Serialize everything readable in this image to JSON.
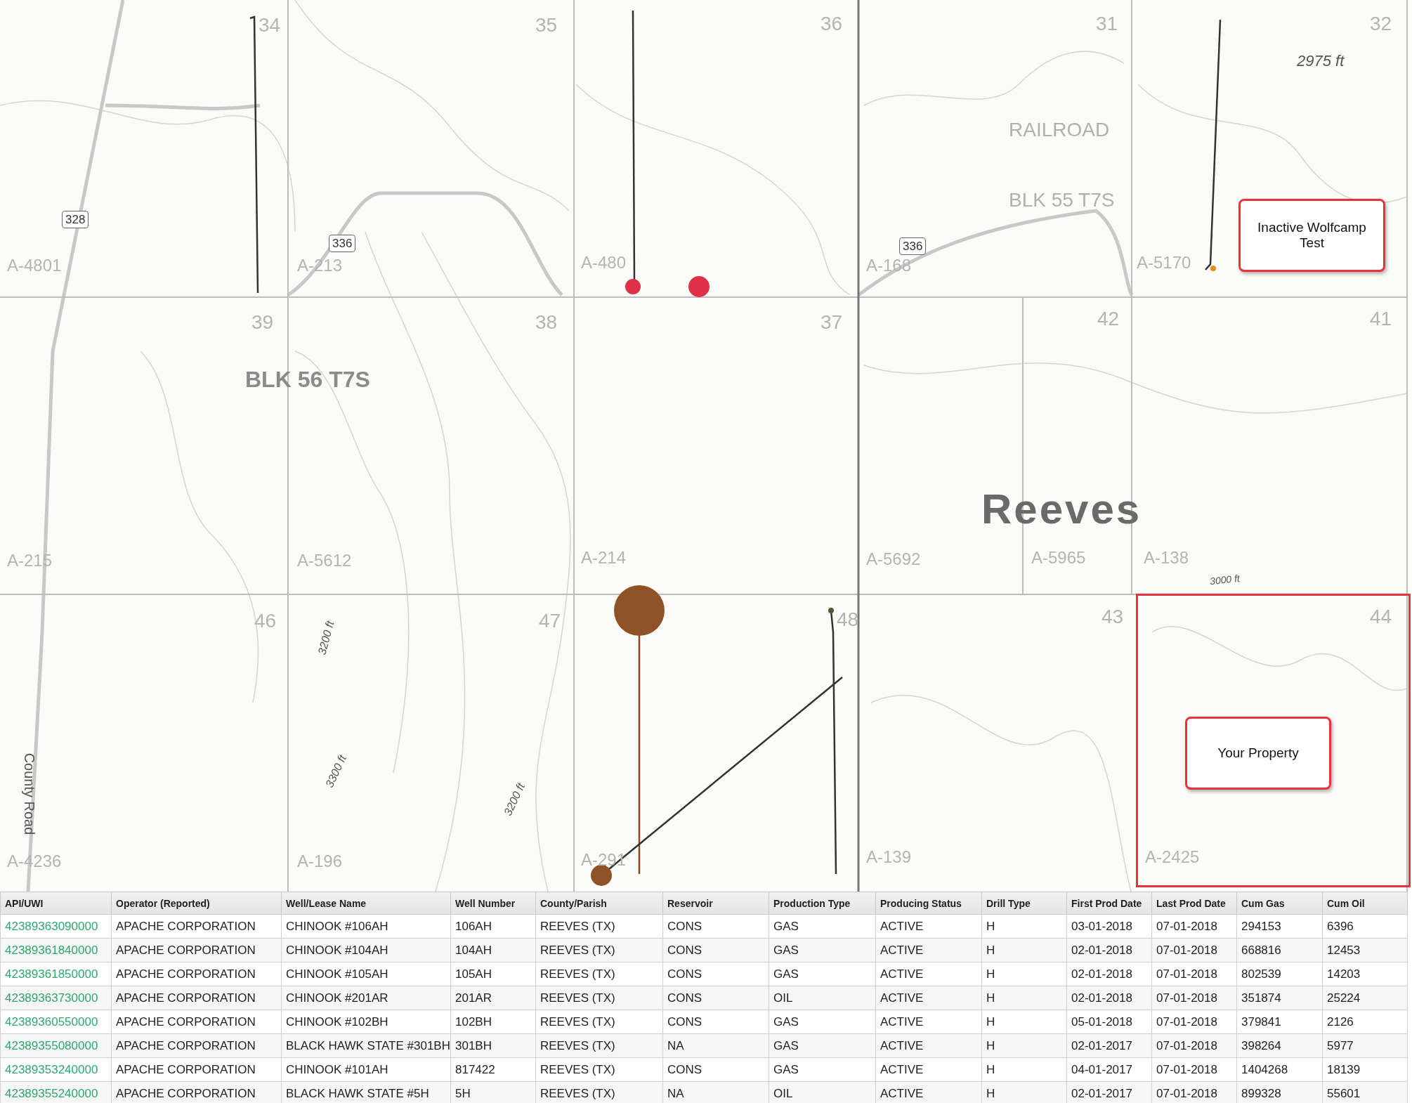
{
  "map": {
    "section_numbers": [
      "34",
      "35",
      "36",
      "31",
      "32",
      "39",
      "38",
      "37",
      "42",
      "41",
      "46",
      "47",
      "48",
      "43",
      "44"
    ],
    "abstract_labels": [
      "A-4801",
      "A-213",
      "A-480",
      "A-168",
      "A-5170",
      "A-215",
      "A-5612",
      "A-214",
      "A-5692",
      "A-5965",
      "A-138",
      "A-4236",
      "A-196",
      "A-291",
      "A-139",
      "A-2425"
    ],
    "block_labels": [
      "BLK 56 T7S",
      "RAILROAD",
      "BLK 55 T7S"
    ],
    "county_label": "Reeves",
    "elevation_labels": [
      "2975 ft",
      "3000 ft",
      "3200 ft",
      "3300 ft",
      "3200 ft"
    ],
    "road_label": "County Road",
    "route_shields": [
      "328",
      "336",
      "336"
    ],
    "callouts": [
      {
        "kind": "note",
        "text": "Inactive Wolfcamp Test"
      },
      {
        "kind": "property",
        "text": "Your Property"
      }
    ]
  },
  "table": {
    "columns": [
      "API/UWI",
      "Operator (Reported)",
      "Well/Lease Name",
      "Well Number",
      "County/Parish",
      "Reservoir",
      "Production Type",
      "Producing Status",
      "Drill Type",
      "First Prod Date",
      "Last Prod Date",
      "Cum Gas",
      "Cum Oil"
    ],
    "rows": [
      [
        "42389363090000",
        "APACHE CORPORATION",
        "CHINOOK #106AH",
        "106AH",
        "REEVES (TX)",
        "CONS",
        "GAS",
        "ACTIVE",
        "H",
        "03-01-2018",
        "07-01-2018",
        "294153",
        "6396"
      ],
      [
        "42389361840000",
        "APACHE CORPORATION",
        "CHINOOK #104AH",
        "104AH",
        "REEVES (TX)",
        "CONS",
        "GAS",
        "ACTIVE",
        "H",
        "02-01-2018",
        "07-01-2018",
        "668816",
        "12453"
      ],
      [
        "42389361850000",
        "APACHE CORPORATION",
        "CHINOOK #105AH",
        "105AH",
        "REEVES (TX)",
        "CONS",
        "GAS",
        "ACTIVE",
        "H",
        "02-01-2018",
        "07-01-2018",
        "802539",
        "14203"
      ],
      [
        "42389363730000",
        "APACHE CORPORATION",
        "CHINOOK #201AR",
        "201AR",
        "REEVES (TX)",
        "CONS",
        "OIL",
        "ACTIVE",
        "H",
        "02-01-2018",
        "07-01-2018",
        "351874",
        "25224"
      ],
      [
        "42389360550000",
        "APACHE CORPORATION",
        "CHINOOK #102BH",
        "102BH",
        "REEVES (TX)",
        "CONS",
        "GAS",
        "ACTIVE",
        "H",
        "05-01-2018",
        "07-01-2018",
        "379841",
        "2126"
      ],
      [
        "42389355080000",
        "APACHE CORPORATION",
        "BLACK HAWK STATE #301BH",
        "301BH",
        "REEVES (TX)",
        "NA",
        "GAS",
        "ACTIVE",
        "H",
        "02-01-2017",
        "07-01-2018",
        "398264",
        "5977"
      ],
      [
        "42389353240000",
        "APACHE CORPORATION",
        "CHINOOK #101AH",
        "817422",
        "REEVES (TX)",
        "CONS",
        "GAS",
        "ACTIVE",
        "H",
        "04-01-2017",
        "07-01-2018",
        "1404268",
        "18139"
      ],
      [
        "42389355240000",
        "APACHE CORPORATION",
        "BLACK HAWK STATE #5H",
        "5H",
        "REEVES (TX)",
        "NA",
        "OIL",
        "ACTIVE",
        "H",
        "02-01-2017",
        "07-01-2018",
        "899328",
        "55601"
      ]
    ]
  }
}
